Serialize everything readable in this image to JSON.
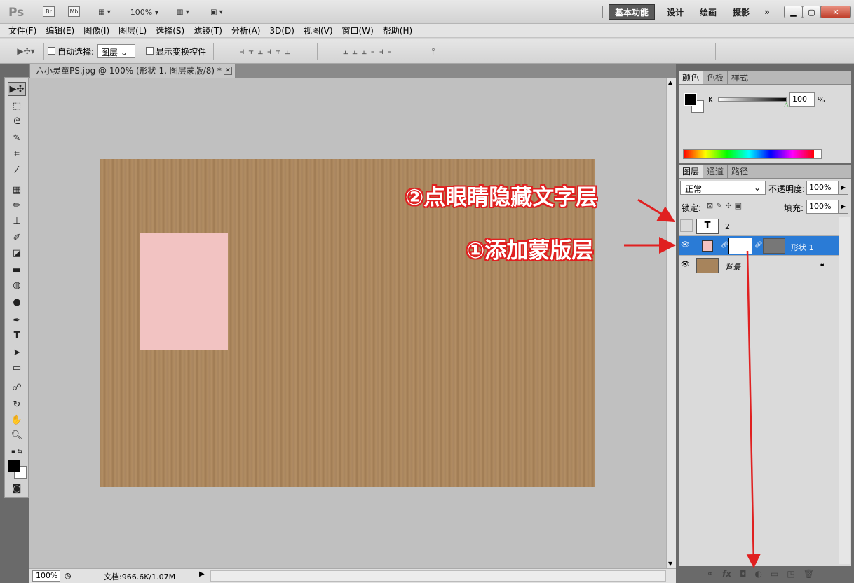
{
  "app": {
    "logo": "Ps",
    "bridge": "Br",
    "minibridge": "Mb",
    "zoom": "100%"
  },
  "workspaces": [
    "基本功能",
    "设计",
    "绘画",
    "摄影",
    "»"
  ],
  "menus": [
    "文件(F)",
    "编辑(E)",
    "图像(I)",
    "图层(L)",
    "选择(S)",
    "滤镜(T)",
    "分析(A)",
    "3D(D)",
    "视图(V)",
    "窗口(W)",
    "帮助(H)"
  ],
  "options": {
    "auto_select": "自动选择:",
    "auto_select_value": "图层",
    "show_transform": "显示变换控件"
  },
  "document": {
    "tab": "六小灵童PS.jpg @ 100% (形状 1, 图层蒙版/8) *",
    "zoom": "100%",
    "doc_info": "文档:966.6K/1.07M"
  },
  "color_panel": {
    "tabs": [
      "颜色",
      "色板",
      "样式"
    ],
    "channel": "K",
    "value": "100",
    "unit": "%"
  },
  "layers_panel": {
    "tabs": [
      "图层",
      "通道",
      "路径"
    ],
    "blend": "正常",
    "opacity_label": "不透明度:",
    "opacity": "100%",
    "lock_label": "锁定:",
    "fill_label": "填充:",
    "fill": "100%",
    "layers": [
      {
        "name": "2",
        "type": "T"
      },
      {
        "name": "形状 1"
      },
      {
        "name": "背景"
      }
    ]
  },
  "annotations": {
    "hide_text": "②点眼睛隐藏文字层",
    "add_mask": "①添加蒙版层"
  },
  "colors": {
    "accent": "#2a7bd6",
    "arrow": "#e02020",
    "pink": "#f2c3c2",
    "cardboard": "#a7845c"
  }
}
